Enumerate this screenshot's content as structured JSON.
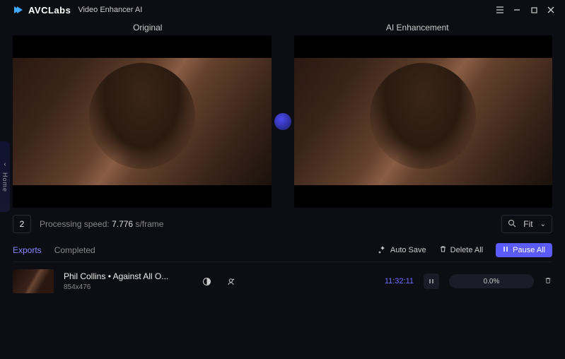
{
  "app": {
    "brand": "AVCLabs",
    "name": "Video Enhancer AI"
  },
  "sidebar": {
    "label": "Home"
  },
  "compare": {
    "left_label": "Original",
    "right_label": "AI Enhancement"
  },
  "status": {
    "frame": "2",
    "speed_label": "Processing speed:",
    "speed_value": "7.776",
    "speed_unit": "s/frame",
    "zoom_mode": "Fit"
  },
  "tabs": {
    "exports": "Exports",
    "completed": "Completed"
  },
  "actions": {
    "auto_save": "Auto Save",
    "delete_all": "Delete All",
    "pause_all": "Pause All"
  },
  "exports": [
    {
      "title": "Phil Collins  •  Against All O...",
      "resolution": "854x476",
      "elapsed": "11:32:11",
      "progress": "0.0%"
    }
  ]
}
